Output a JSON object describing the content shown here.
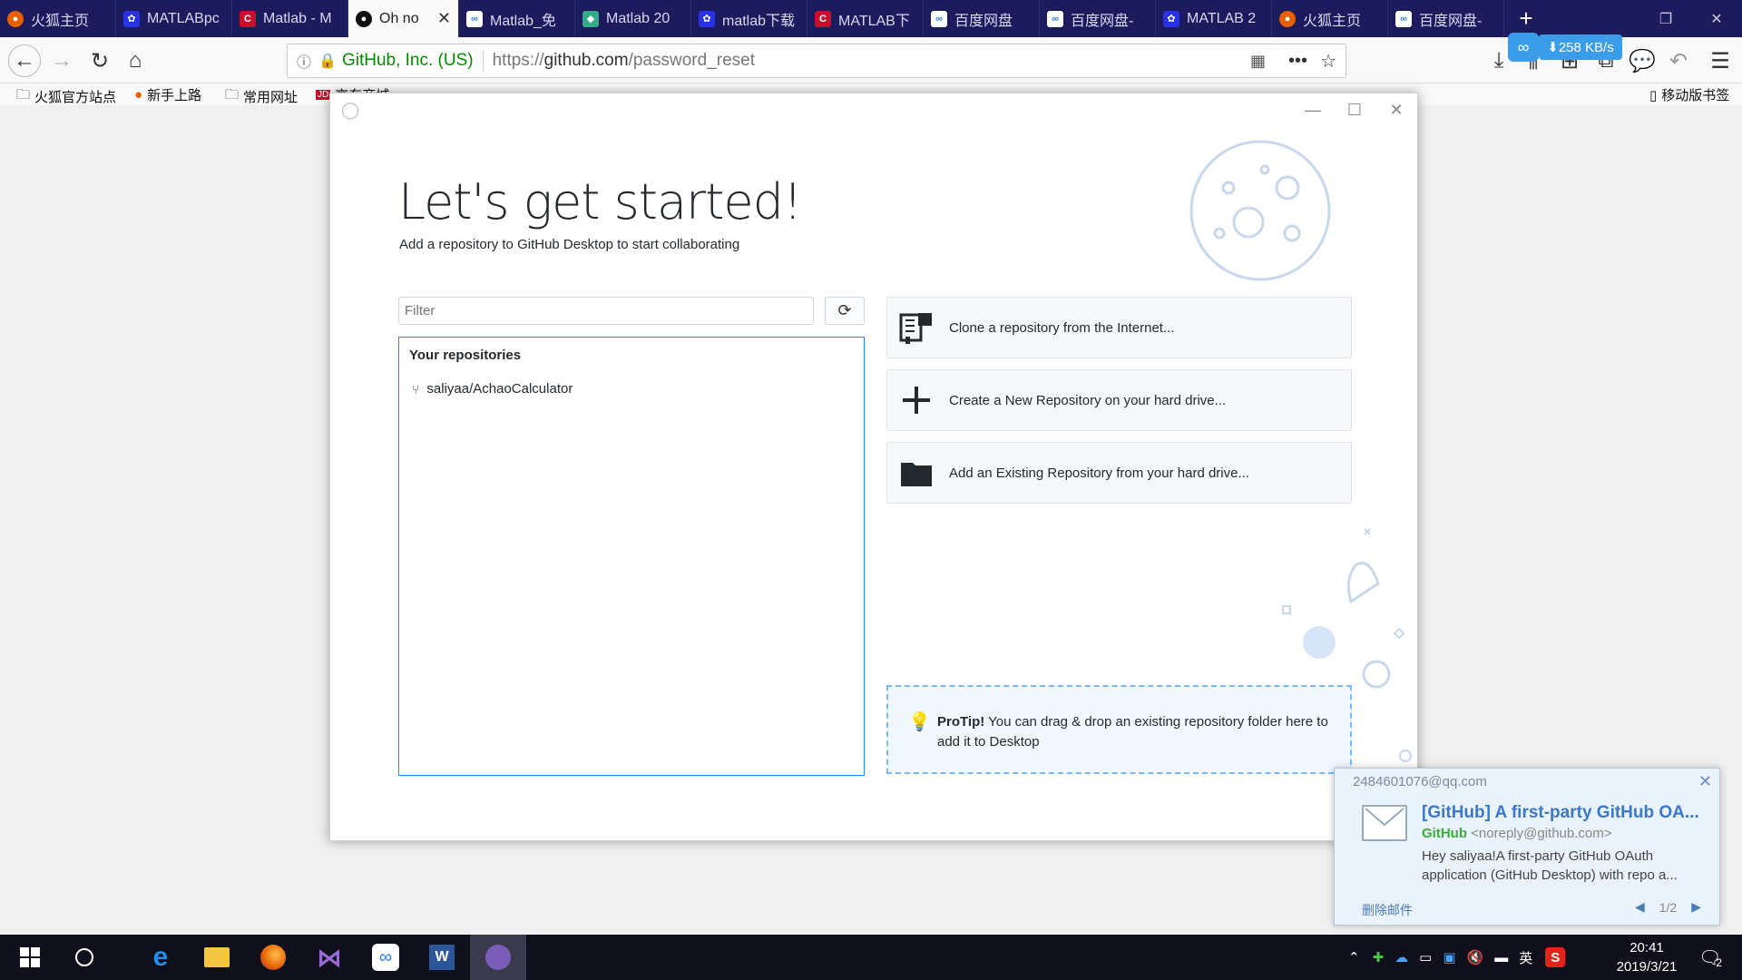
{
  "browser": {
    "tabs": [
      {
        "label": "火狐主页",
        "icon": "firefox-icon"
      },
      {
        "label": "MATLABpc",
        "icon": "baidu-paw-icon"
      },
      {
        "label": "Matlab - M",
        "icon": "csdn-icon"
      },
      {
        "label": "Oh no",
        "icon": "github-icon",
        "active": true
      },
      {
        "label": "Matlab_免",
        "icon": "baidu-cloud-icon"
      },
      {
        "label": "Matlab 20",
        "icon": "site-icon"
      },
      {
        "label": "matlab下载",
        "icon": "baidu-paw-icon"
      },
      {
        "label": "MATLAB下",
        "icon": "csdn-icon"
      },
      {
        "label": "百度网盘",
        "icon": "baidu-cloud-icon"
      },
      {
        "label": "百度网盘-",
        "icon": "baidu-cloud-icon"
      },
      {
        "label": "MATLAB 2",
        "icon": "baidu-paw-icon"
      },
      {
        "label": "火狐主页",
        "icon": "firefox-icon"
      },
      {
        "label": "百度网盘-",
        "icon": "baidu-cloud-icon"
      }
    ],
    "url_org": "GitHub, Inc. (US)",
    "url_prefix": "https://",
    "url_domain": "github.com",
    "url_path": "/password_reset",
    "speed": "258 KB/s",
    "bookmarks": [
      "火狐官方站点",
      "新手上路",
      "常用网址",
      "京东商城"
    ],
    "mobile_bookmarks": "移动版书签"
  },
  "app": {
    "headline": "Let's get started!",
    "subline": "Add a repository to GitHub Desktop to start collaborating",
    "filter_placeholder": "Filter",
    "repos_header": "Your repositories",
    "repos": [
      "saliyaa/AchaoCalculator"
    ],
    "actions": [
      {
        "label": "Clone a repository from the Internet...",
        "icon": "clone-icon"
      },
      {
        "label": "Create a New Repository on your hard drive...",
        "icon": "plus-icon"
      },
      {
        "label": "Add an Existing Repository from your hard drive...",
        "icon": "folder-icon"
      }
    ],
    "protip_bold": "ProTip!",
    "protip_text": " You can drag & drop an existing repository folder here to add it to Desktop"
  },
  "notification": {
    "from": "2484601076@qq.com",
    "subject": "[GitHub] A first-party GitHub OA...",
    "sender_name": "GitHub",
    "sender_email": "<noreply@github.com>",
    "body": "Hey saliyaa!A first-party GitHub OAuth application (GitHub Desktop) with repo a...",
    "delete_label": "删除邮件",
    "pager": "1/2"
  },
  "taskbar": {
    "time": "20:41",
    "date": "2019/3/21",
    "ime": "英",
    "notification_count": "2"
  },
  "colors": {
    "tabbar": "#1b1b5e",
    "accent_blue": "#2188ff",
    "taskbar": "#10101c"
  }
}
